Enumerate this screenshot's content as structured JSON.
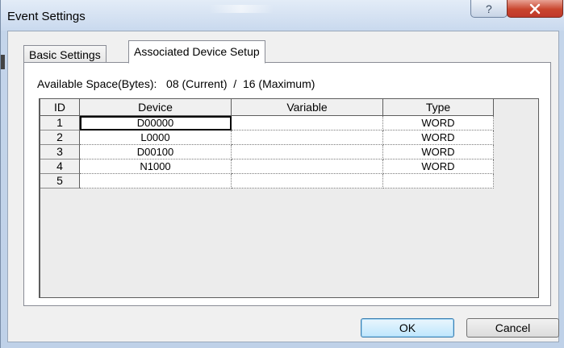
{
  "window": {
    "title": "Event Settings",
    "help_label": "?",
    "close_label": "X"
  },
  "tabs": [
    {
      "label": "Basic Settings",
      "active": false
    },
    {
      "label": "Associated Device Setup",
      "active": true
    }
  ],
  "available_space": {
    "text": "Available Space(Bytes):   08 (Current)  /  16 (Maximum)"
  },
  "grid": {
    "columns": [
      "ID",
      "Device",
      "Variable",
      "Type"
    ],
    "rows": [
      {
        "id": "1",
        "device": "D00000",
        "variable": "",
        "type": "WORD"
      },
      {
        "id": "2",
        "device": "L0000",
        "variable": "",
        "type": "WORD"
      },
      {
        "id": "3",
        "device": "D00100",
        "variable": "",
        "type": "WORD"
      },
      {
        "id": "4",
        "device": "N1000",
        "variable": "",
        "type": "WORD"
      },
      {
        "id": "5",
        "device": "",
        "variable": "",
        "type": ""
      }
    ]
  },
  "buttons": {
    "ok": "OK",
    "cancel": "Cancel"
  }
}
